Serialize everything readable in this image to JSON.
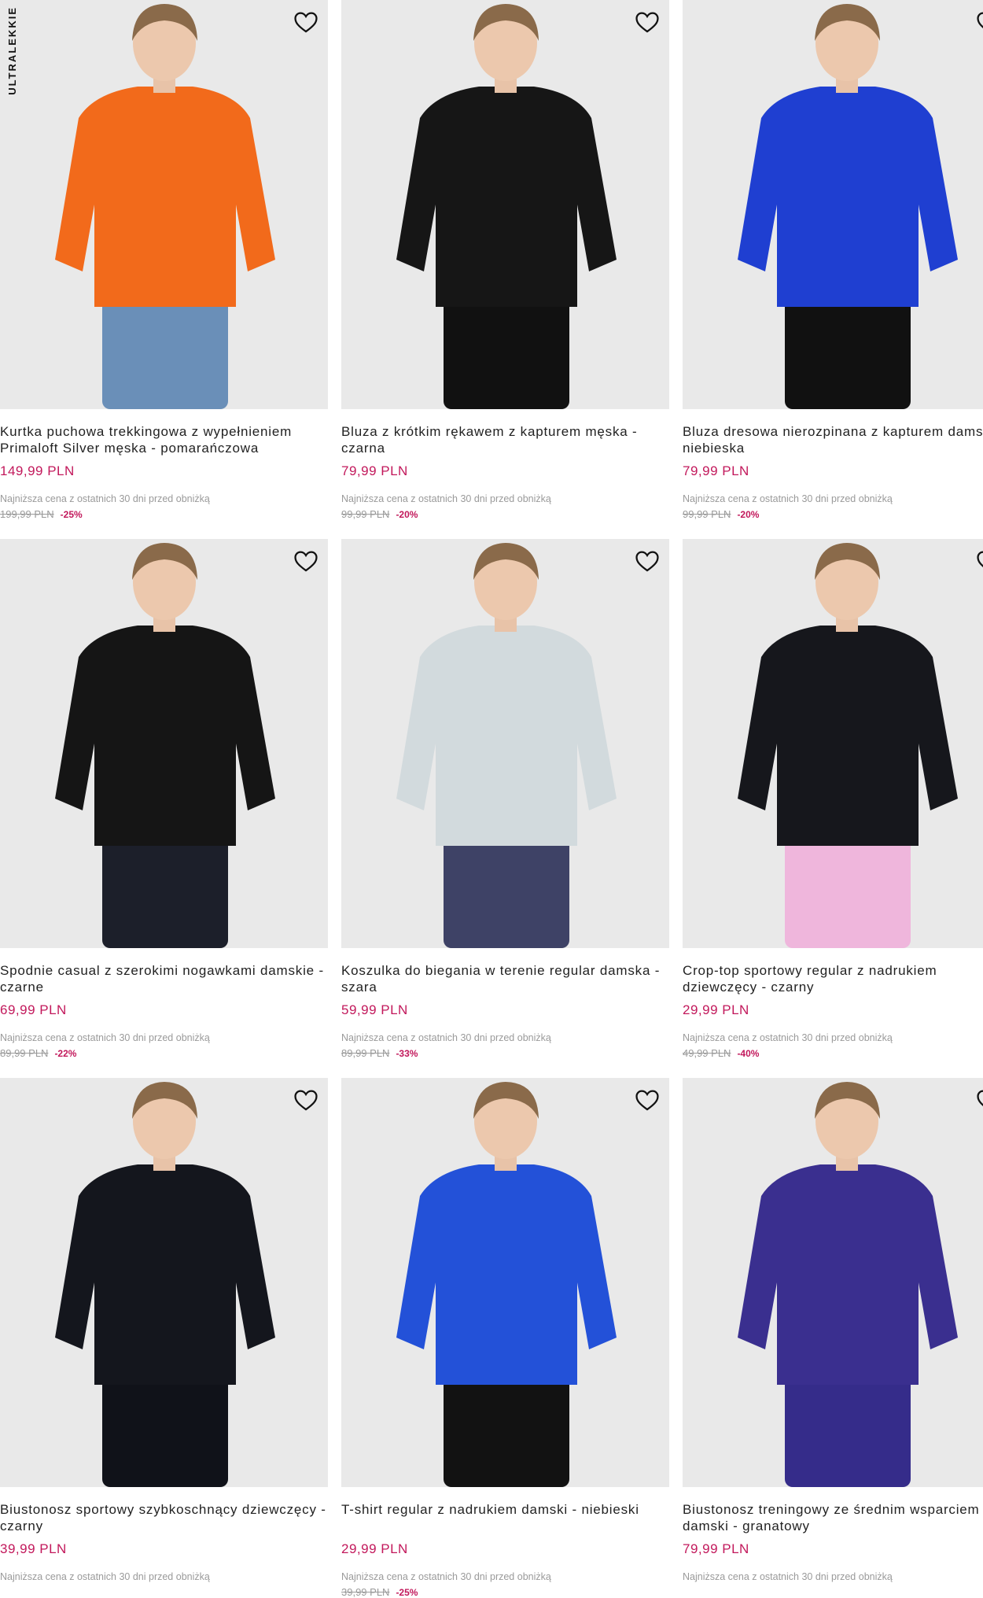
{
  "products": [
    {
      "name": "Kurtka puchowa trekkingowa z wypełnieniem Primaloft Silver męska - pomarańczowa",
      "price": "149,99 PLN",
      "lowest": "Najniższa cena z ostatnich 30 dni przed obniżką",
      "old": "199,99 PLN",
      "discount": "-25%",
      "badge": "ULTRALEKKIE",
      "color": "#f26a1b",
      "bottom": "#6a8fb8"
    },
    {
      "name": "Bluza z krótkim rękawem z kapturem męska - czarna",
      "price": "79,99 PLN",
      "lowest": "Najniższa cena z ostatnich 30 dni przed obniżką",
      "old": "99,99 PLN",
      "discount": "-20%",
      "color": "#161616",
      "bottom": "#111111"
    },
    {
      "name": "Bluza dresowa nierozpinana z kapturem damska - niebieska",
      "price": "79,99 PLN",
      "lowest": "Najniższa cena z ostatnich 30 dni przed obniżką",
      "old": "99,99 PLN",
      "discount": "-20%",
      "color": "#1f3fd1",
      "bottom": "#111111"
    },
    {
      "name": "Spodnie casual z szerokimi nogawkami damskie - czarne",
      "price": "69,99 PLN",
      "lowest": "Najniższa cena z ostatnich 30 dni przed obniżką",
      "old": "89,99 PLN",
      "discount": "-22%",
      "color": "#151515",
      "bottom": "#1c1f2a"
    },
    {
      "name": "Koszulka do biegania w terenie regular damska - szara",
      "price": "59,99 PLN",
      "lowest": "Najniższa cena z ostatnich 30 dni przed obniżką",
      "old": "89,99 PLN",
      "discount": "-33%",
      "color": "#d2dadd",
      "bottom": "#3e4266"
    },
    {
      "name": "Crop-top sportowy regular z nadrukiem dziewczęcy - czarny",
      "price": "29,99 PLN",
      "lowest": "Najniższa cena z ostatnich 30 dni przed obniżką",
      "old": "49,99 PLN",
      "discount": "-40%",
      "color": "#16171c",
      "bottom": "#efb6dc"
    },
    {
      "name": "Biustonosz sportowy szybkoschnący dziewczęcy - czarny",
      "price": "39,99 PLN",
      "lowest": "Najniższa cena z ostatnich 30 dni przed obniżką",
      "old": "",
      "discount": "",
      "color": "#14161d",
      "bottom": "#101219"
    },
    {
      "name": "T-shirt regular z nadrukiem damski - niebieski",
      "price": "29,99 PLN",
      "lowest": "Najniższa cena z ostatnich 30 dni przed obniżką",
      "old": "39,99 PLN",
      "discount": "-25%",
      "color": "#2351d8",
      "bottom": "#121212"
    },
    {
      "name": "Biustonosz treningowy ze średnim wsparciem damski - granatowy",
      "price": "79,99 PLN",
      "lowest": "Najniższa cena z ostatnich 30 dni przed obniżką",
      "old": "",
      "discount": "",
      "color": "#3a2f8f",
      "bottom": "#352c8a"
    }
  ],
  "icons": {
    "favorite": "heart-outline-icon"
  },
  "colors": {
    "price": "#c2185b",
    "muted": "#9a9a9a",
    "image_bg": "#eaeaea"
  }
}
